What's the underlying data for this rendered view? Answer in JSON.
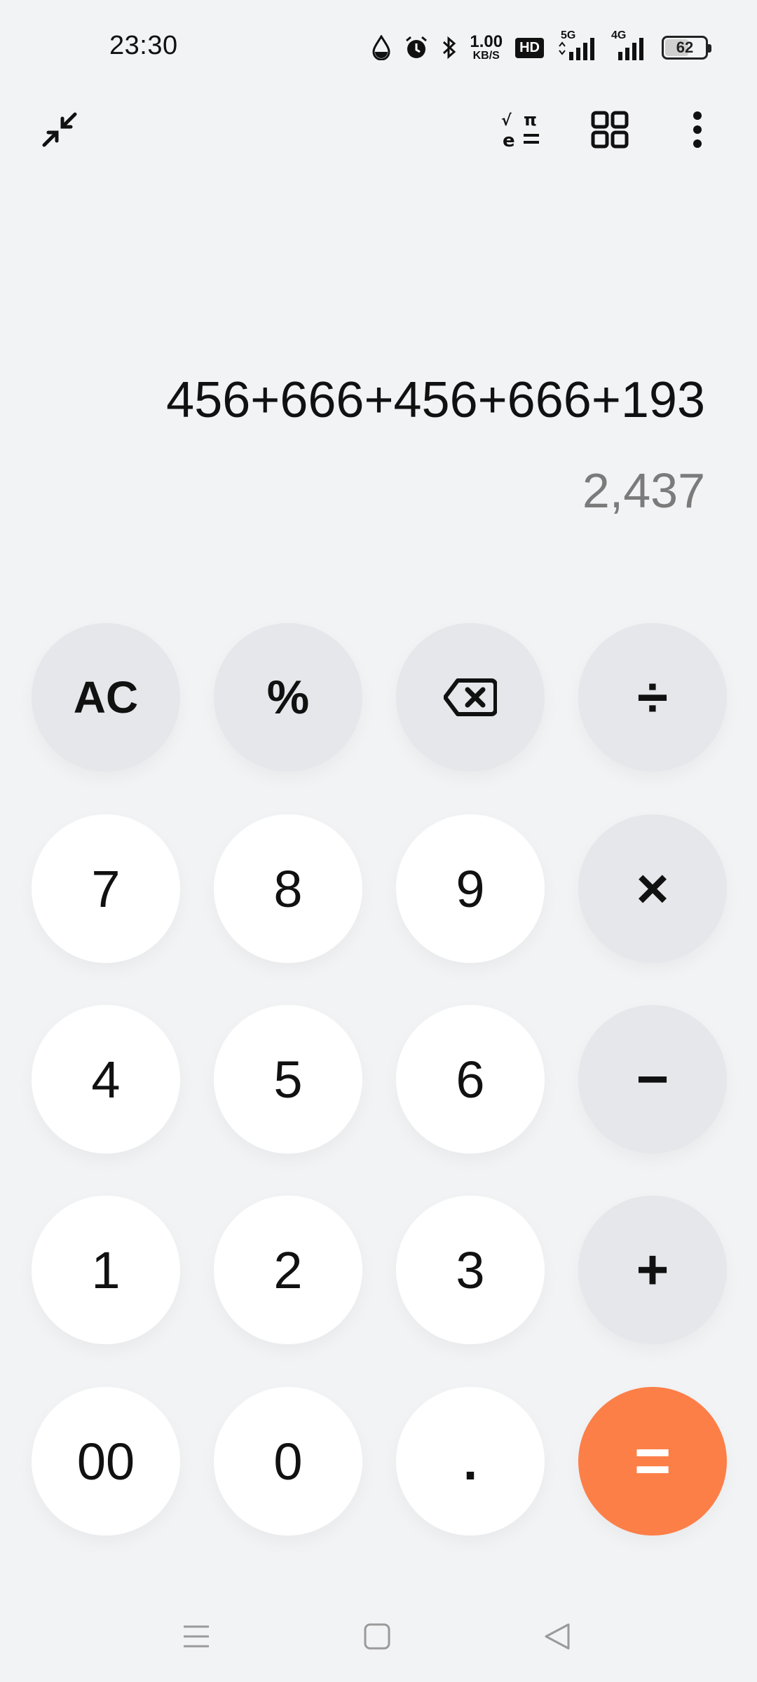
{
  "status_bar": {
    "time": "23:30",
    "net_speed_value": "1.00",
    "net_speed_unit": "KB/S",
    "hd_badge": "HD",
    "signal1_label": "5G",
    "signal2_label": "4G",
    "battery_level": 62,
    "battery_text": "62",
    "icons": [
      "drop-icon",
      "alarm-icon",
      "bluetooth-icon",
      "hd-voice-icon",
      "signal-5g-icon",
      "signal-4g-icon",
      "battery-icon"
    ]
  },
  "toolbar": {
    "icons": [
      "collapse-icon",
      "scientific-mode-icon",
      "grid-menu-icon",
      "more-options-icon"
    ]
  },
  "display": {
    "expression": "456+666+456+666+193",
    "result": "2,437"
  },
  "keypad": {
    "ac": "AC",
    "percent": "%",
    "divide": "÷",
    "multiply": "×",
    "minus": "−",
    "plus": "+",
    "equals": "=",
    "k7": "7",
    "k8": "8",
    "k9": "9",
    "k4": "4",
    "k5": "5",
    "k6": "6",
    "k1": "1",
    "k2": "2",
    "k3": "3",
    "k00": "00",
    "k0": "0",
    "dot": "."
  },
  "colors": {
    "background": "#f2f3f5",
    "digit_key": "#ffffff",
    "operator_key": "#e6e7ea",
    "equals_key": "#fc7f48",
    "result_text": "#7b7b7b"
  },
  "nav_bar": {
    "icons": [
      "menu-icon",
      "home-icon",
      "back-icon"
    ]
  }
}
